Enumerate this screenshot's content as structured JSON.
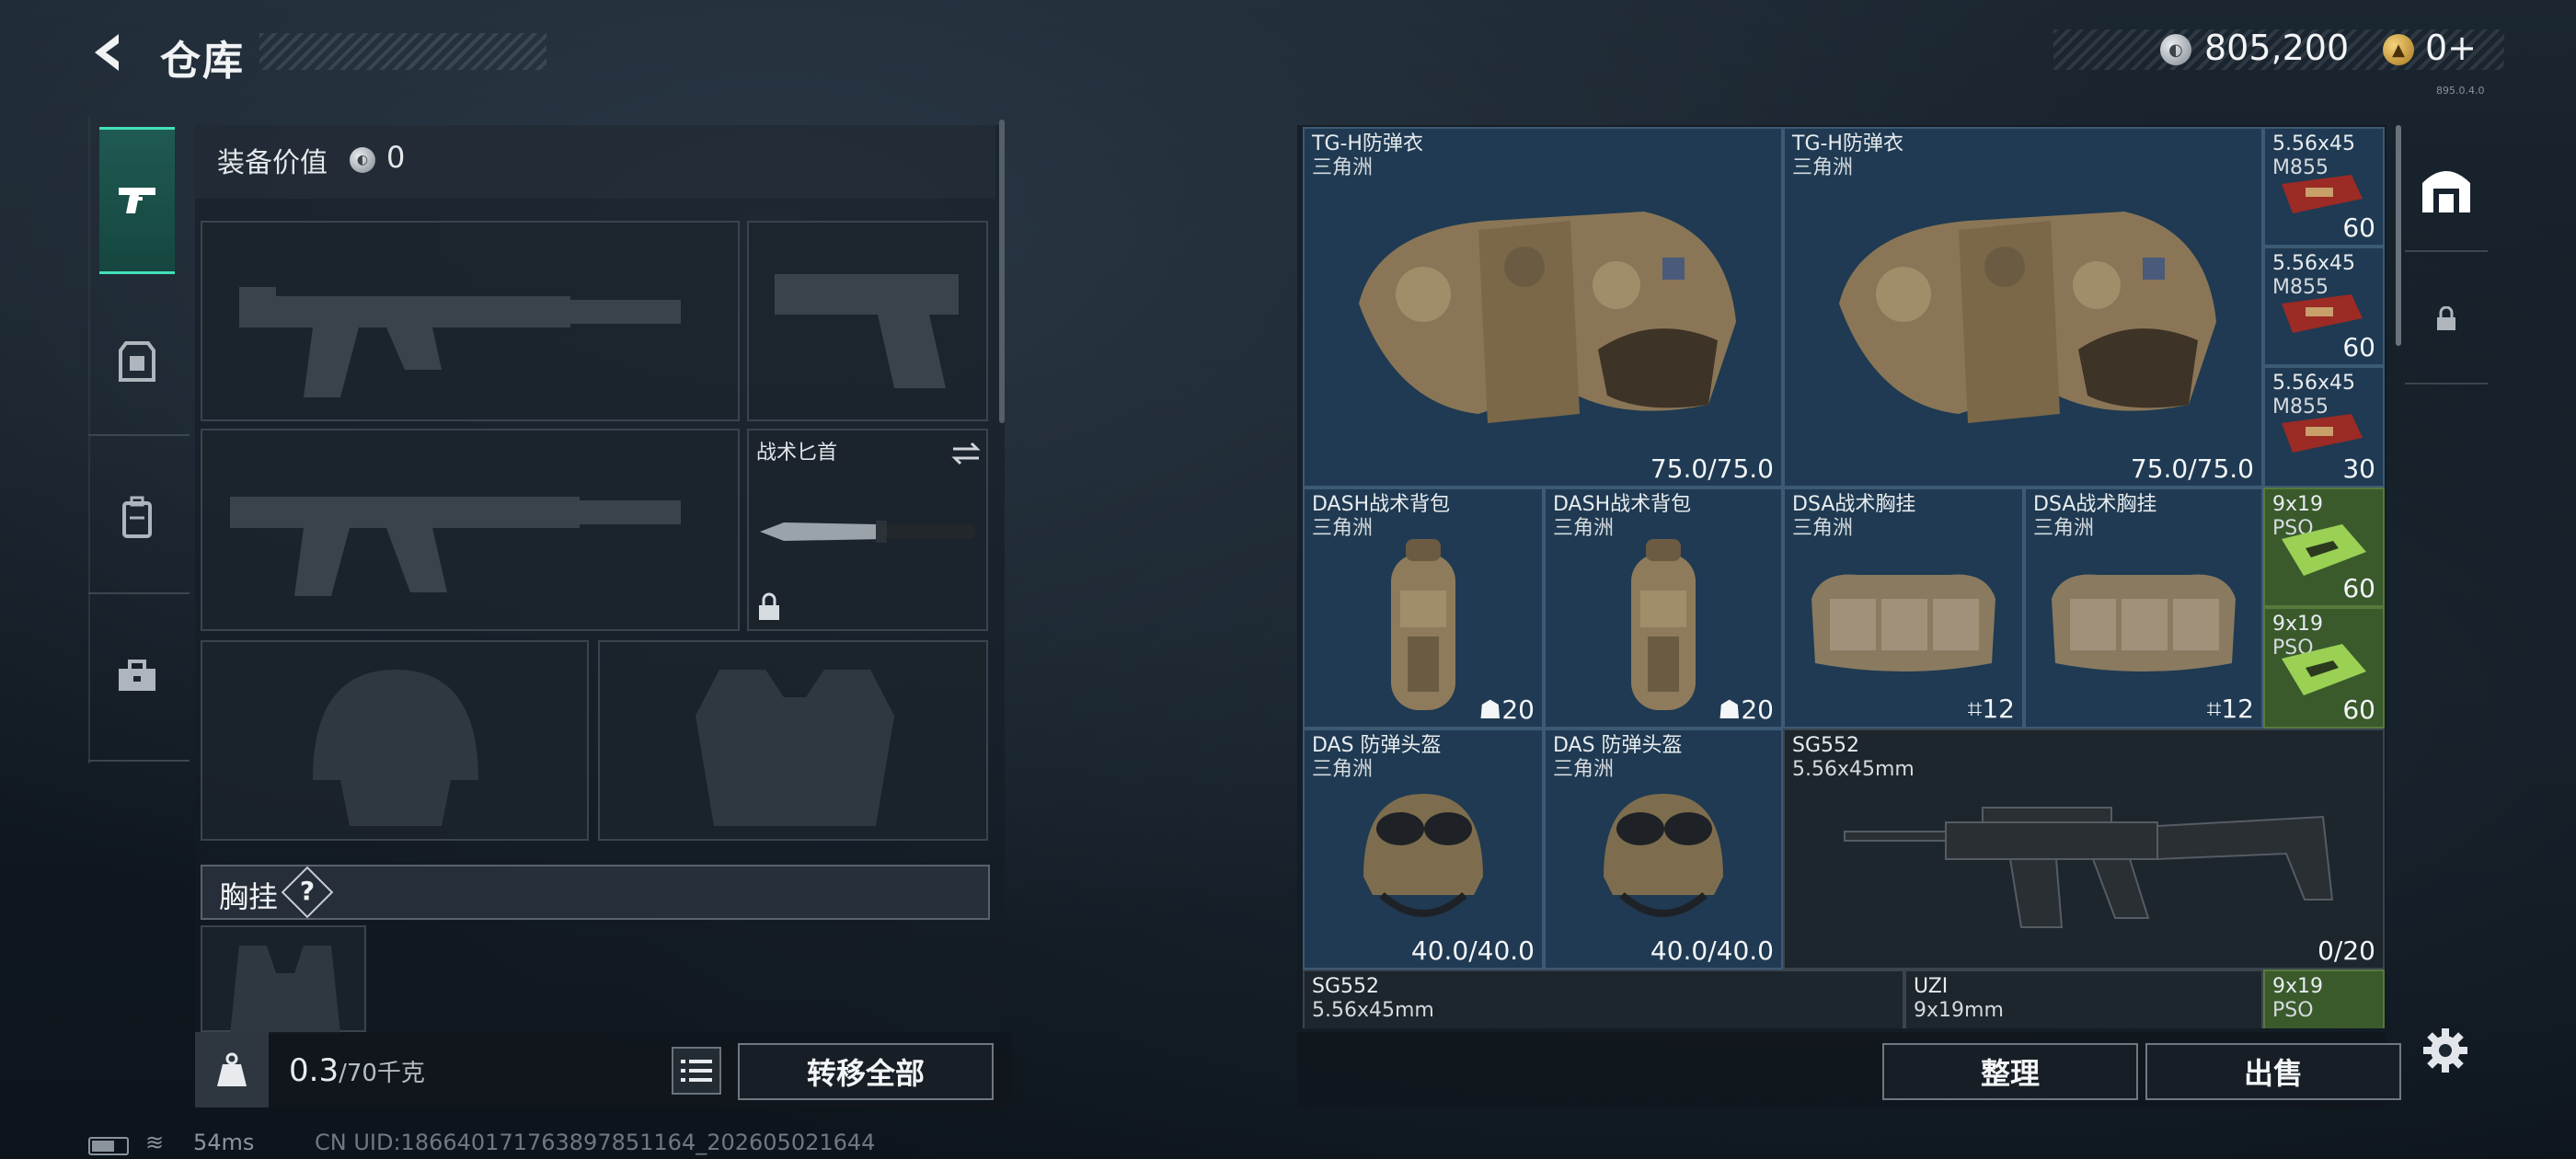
{
  "header": {
    "title": "仓库",
    "currency_main": "805,200",
    "currency_token": "0+",
    "version": "895.0.4.0"
  },
  "left": {
    "equip_value_label": "装备价值",
    "equip_value": "0",
    "knife_label": "战术匕首",
    "chest_label": "胸挂",
    "help": "?",
    "weight_value": "0.3",
    "weight_max": "/70千克",
    "transfer_all": "转移全部"
  },
  "stash": {
    "items": [
      {
        "name": "TG-H防弹衣",
        "sub": "三角洲",
        "count": "75.0/75.0"
      },
      {
        "name": "TG-H防弹衣",
        "sub": "三角洲",
        "count": "75.0/75.0"
      },
      {
        "name": "5.56x45",
        "sub": "M855",
        "count": "60"
      },
      {
        "name": "5.56x45",
        "sub": "M855",
        "count": "60"
      },
      {
        "name": "5.56x45",
        "sub": "M855",
        "count": "30"
      },
      {
        "name": "DASH战术背包",
        "sub": "三角洲",
        "count": "20"
      },
      {
        "name": "DASH战术背包",
        "sub": "三角洲",
        "count": "20"
      },
      {
        "name": "DSA战术胸挂",
        "sub": "三角洲",
        "count": "12"
      },
      {
        "name": "DSA战术胸挂",
        "sub": "三角洲",
        "count": "12"
      },
      {
        "name": "9x19",
        "sub": "PSO",
        "count": "60"
      },
      {
        "name": "9x19",
        "sub": "PSO",
        "count": "60"
      },
      {
        "name": "DAS 防弹头盔",
        "sub": "三角洲",
        "count": "40.0/40.0"
      },
      {
        "name": "DAS 防弹头盔",
        "sub": "三角洲",
        "count": "40.0/40.0"
      },
      {
        "name": "SG552",
        "sub": "5.56x45mm",
        "count": "0/20"
      },
      {
        "name": "SG552",
        "sub": "5.56x45mm",
        "count": ""
      },
      {
        "name": "UZI",
        "sub": "9x19mm",
        "count": ""
      },
      {
        "name": "9x19",
        "sub": "PSO",
        "count": ""
      }
    ],
    "sort": "整理",
    "sell": "出售"
  },
  "status": {
    "ping": "54ms",
    "uid": "CN UID:18664017176389785116​4_202605021644"
  },
  "colors": {
    "accent": "#43e0b8",
    "grid_blue": "#1c3348",
    "ammo_red": "#9c2a25",
    "ammo_green": "#6aa83a"
  }
}
